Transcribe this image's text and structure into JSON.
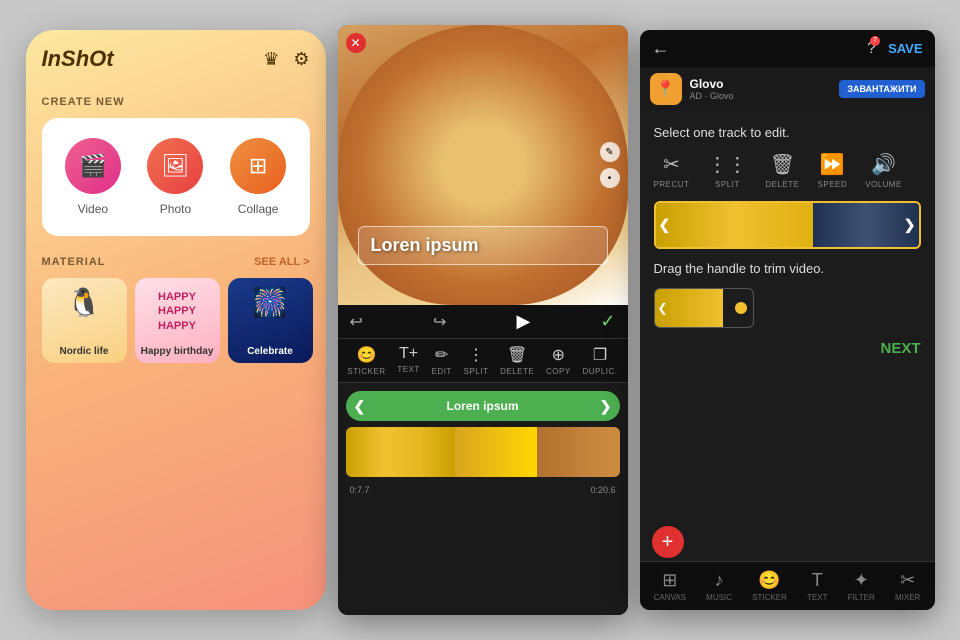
{
  "bg_color": "#c8c8c8",
  "phone1": {
    "logo": "InShOt",
    "create_new_label": "CREATE NEW",
    "items": [
      {
        "label": "Video",
        "icon": "🎬"
      },
      {
        "label": "Photo",
        "icon": "🖼"
      },
      {
        "label": "Collage",
        "icon": "⊞"
      }
    ],
    "material_label": "MATERIAL",
    "see_all": "SEE ALL >",
    "materials": [
      {
        "label": "Nordic life"
      },
      {
        "label": "Happy birthday"
      },
      {
        "label": "Celebrate"
      }
    ]
  },
  "phone2": {
    "text_overlay": "Loren ipsum",
    "text_track_label": "Loren ipsum",
    "toolbar": [
      {
        "label": "STICKER"
      },
      {
        "label": "TEXT"
      },
      {
        "label": "EDIT"
      },
      {
        "label": "SPLIT"
      },
      {
        "label": "DELETE"
      },
      {
        "label": "COPY"
      },
      {
        "label": "DUPLIC."
      }
    ],
    "time_start": "0:7.7",
    "time_end": "0:20.6"
  },
  "phone3": {
    "save_label": "SAVE",
    "ad_name": "Glovo",
    "ad_tag": "AD · Glovo",
    "ad_button": "ЗАВАНТАЖИТИ",
    "select_track_text": "Select one track to edit.",
    "edit_tools": [
      {
        "label": "PRECUT"
      },
      {
        "label": "SPLIT"
      },
      {
        "label": "DELETE"
      },
      {
        "label": "SPEED"
      },
      {
        "label": "VOLUME"
      }
    ],
    "drag_trim_text": "Drag the handle to trim video.",
    "next_label": "NEXT",
    "bottom_tools": [
      {
        "label": "CANVAS"
      },
      {
        "label": "MUSIC"
      },
      {
        "label": "STICKER"
      },
      {
        "label": "TEXT"
      },
      {
        "label": "FILTER"
      },
      {
        "label": "MIXER"
      }
    ]
  }
}
